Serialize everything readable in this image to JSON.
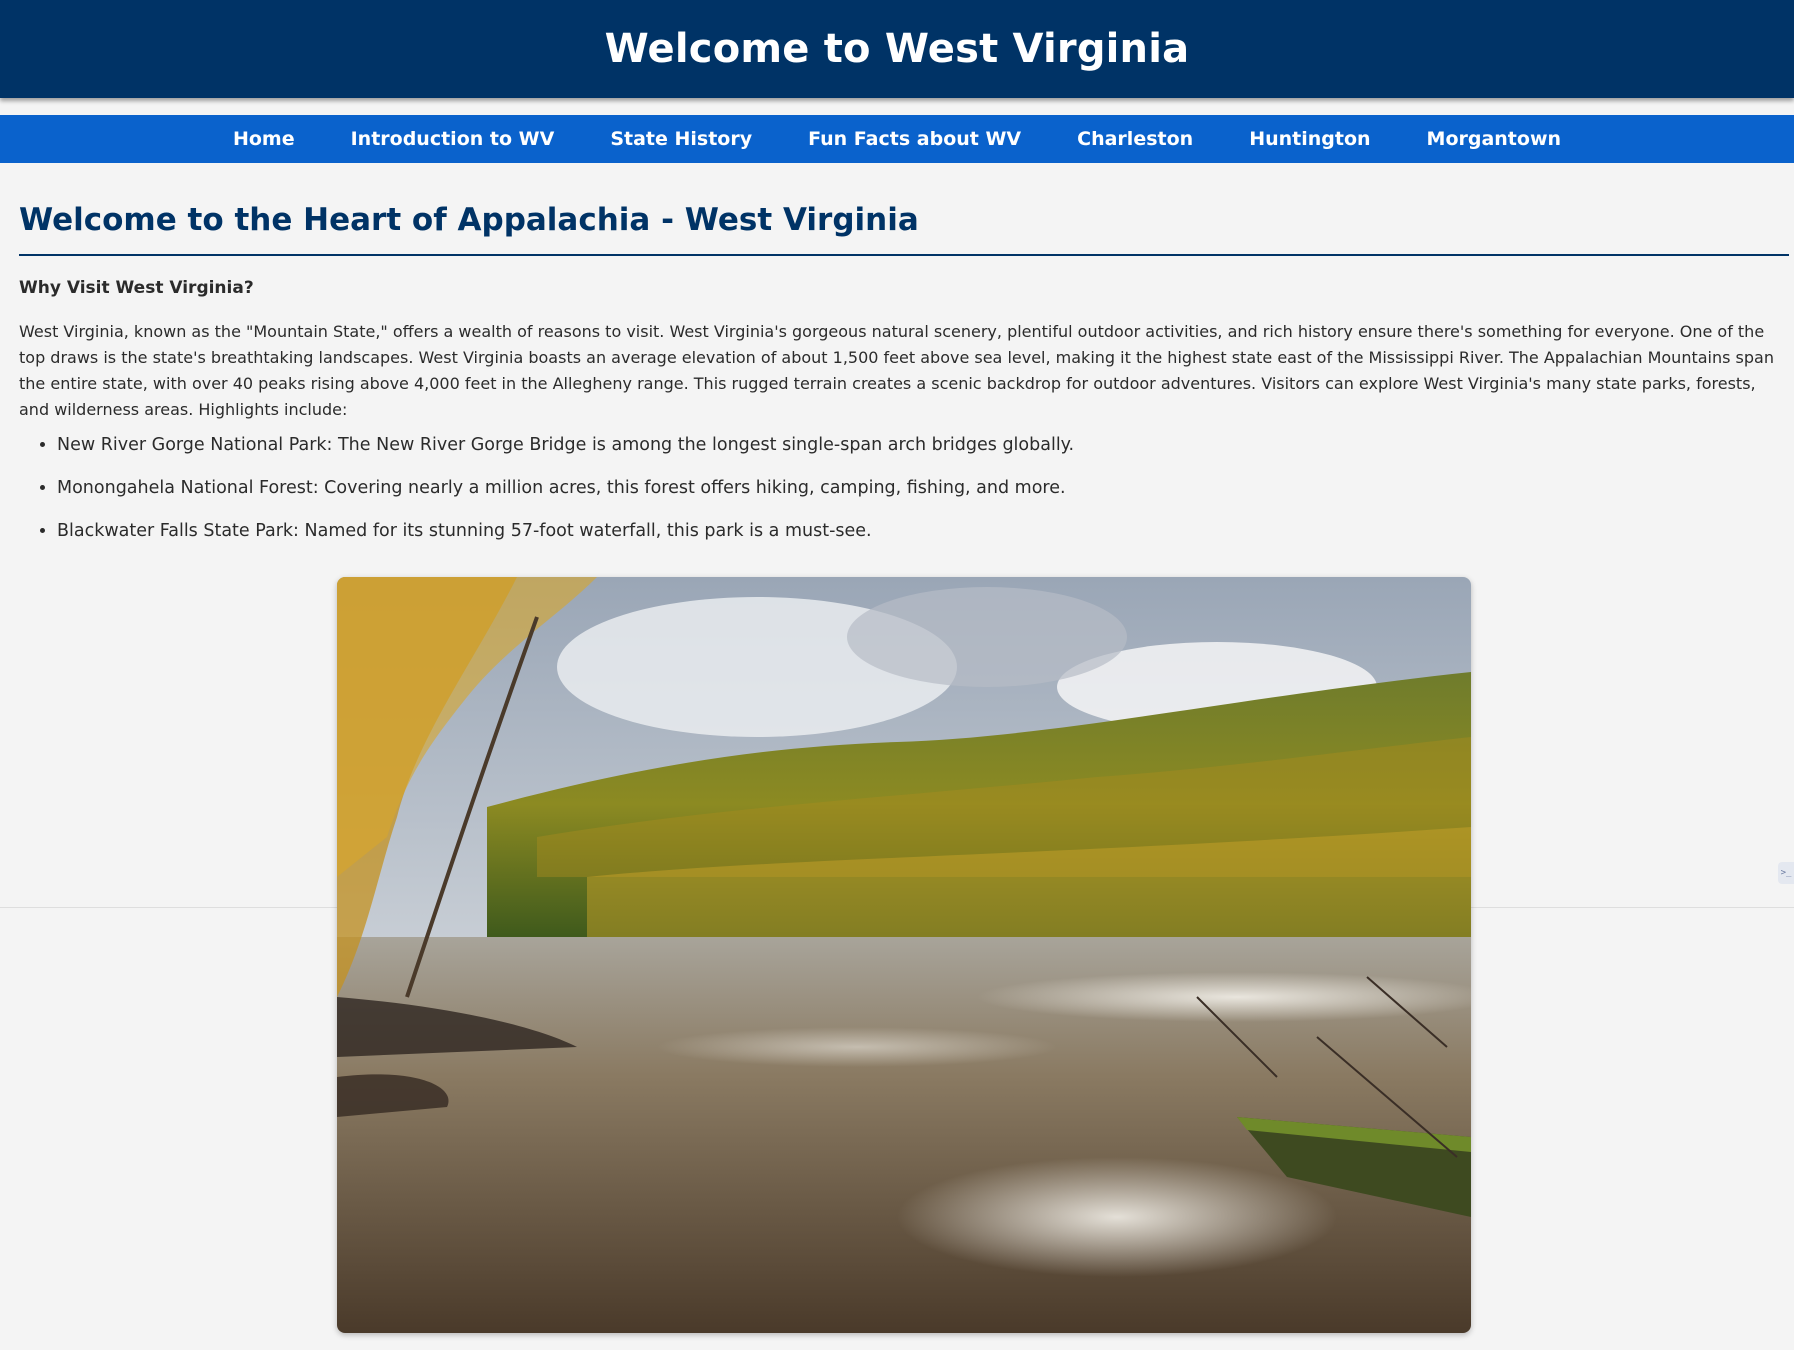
{
  "header": {
    "title": "Welcome to West Virginia"
  },
  "nav": {
    "items": [
      {
        "label": "Home"
      },
      {
        "label": "Introduction to WV"
      },
      {
        "label": "State History"
      },
      {
        "label": "Fun Facts about WV"
      },
      {
        "label": "Charleston"
      },
      {
        "label": "Huntington"
      },
      {
        "label": "Morgantown"
      }
    ]
  },
  "main": {
    "heading": "Welcome to the Heart of Appalachia - West Virginia",
    "subheading": "Why Visit West Virginia?",
    "intro": "West Virginia, known as the \"Mountain State,\" offers a wealth of reasons to visit. West Virginia's gorgeous natural scenery, plentiful outdoor activities, and rich history ensure there's something for everyone. One of the top draws is the state's breathtaking landscapes. West Virginia boasts an average elevation of about 1,500 feet above sea level, making it the highest state east of the Mississippi River. The Appalachian Mountains span the entire state, with over 40 peaks rising above 4,000 feet in the Allegheny range. This rugged terrain creates a scenic backdrop for outdoor adventures. Visitors can explore West Virginia's many state parks, forests, and wilderness areas. Highlights include:",
    "highlights": [
      "New River Gorge National Park: The New River Gorge Bridge is among the longest single-span arch bridges globally.",
      "Monongahela National Forest: Covering nearly a million acres, this forest offers hiking, camping, fishing, and more.",
      "Blackwater Falls State Park: Named for its stunning 57-foot waterfall, this park is a must-see."
    ]
  },
  "side_tab": {
    "label": ">_"
  },
  "colors": {
    "header_bg": "#003366",
    "nav_bg": "#0a62cc",
    "heading": "#003366",
    "page_bg": "#f4f4f4"
  }
}
